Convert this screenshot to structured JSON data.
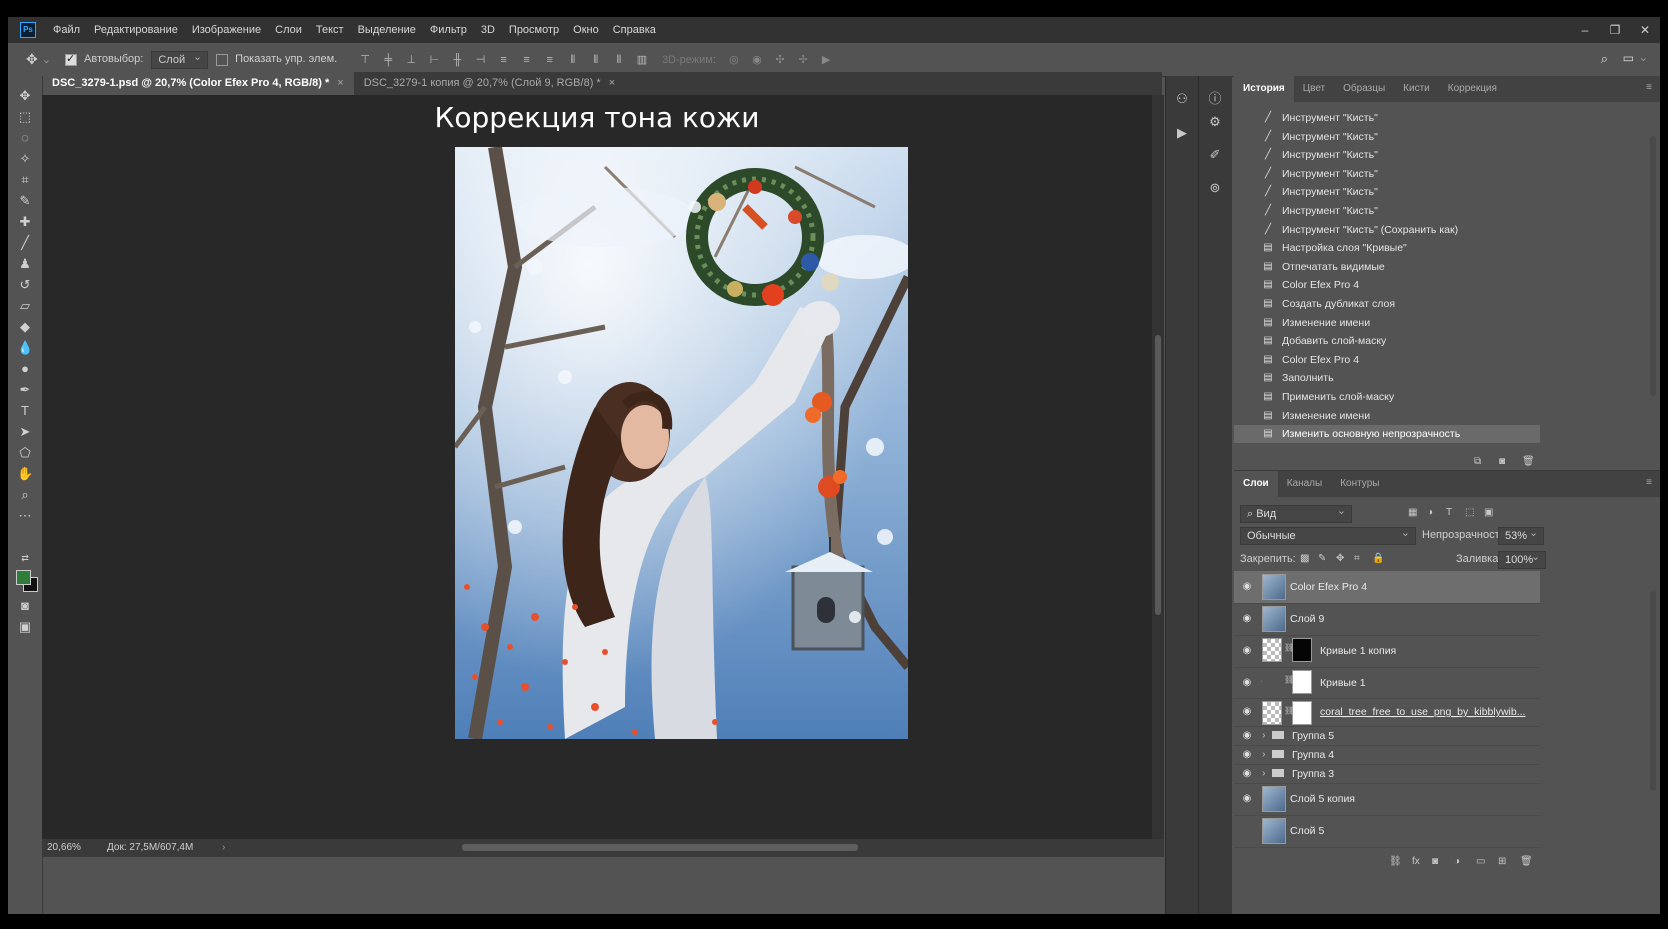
{
  "app": {
    "logo": "Ps"
  },
  "menu": [
    "Файл",
    "Редактирование",
    "Изображение",
    "Слои",
    "Текст",
    "Выделение",
    "Фильтр",
    "3D",
    "Просмотр",
    "Окно",
    "Справка"
  ],
  "options": {
    "autoselect_label": "Автовыбор:",
    "autoselect_value": "Слой",
    "show_transform_label": "Показать упр. элем.",
    "mode_3d": "3D-режим:"
  },
  "tabs": [
    {
      "label": "DSC_3279-1.psd @ 20,7% (Color Efex Pro 4, RGB/8) *",
      "close": "×"
    },
    {
      "label": "DSC_3279-1 копия @ 20,7% (Слой 9, RGB/8) *",
      "close": "×"
    }
  ],
  "canvas": {
    "headline": "Коррекция тона кожи"
  },
  "status": {
    "zoom": "20,66%",
    "doc": "Док: 27,5M/607,4M"
  },
  "history_panel": {
    "tabs": [
      "История",
      "Цвет",
      "Образцы",
      "Кисти",
      "Коррекция"
    ],
    "items": [
      {
        "icon": "brush-icon",
        "label": "Инструмент \"Кисть\""
      },
      {
        "icon": "brush-icon",
        "label": "Инструмент \"Кисть\""
      },
      {
        "icon": "brush-icon",
        "label": "Инструмент \"Кисть\""
      },
      {
        "icon": "brush-icon",
        "label": "Инструмент \"Кисть\""
      },
      {
        "icon": "brush-icon",
        "label": "Инструмент \"Кисть\""
      },
      {
        "icon": "brush-icon",
        "label": "Инструмент \"Кисть\""
      },
      {
        "icon": "brush-icon",
        "label": "Инструмент \"Кисть\" (Сохранить как)"
      },
      {
        "icon": "doc-icon",
        "label": "Настройка слоя \"Кривые\""
      },
      {
        "icon": "doc-icon",
        "label": "Отпечатать видимые"
      },
      {
        "icon": "doc-icon",
        "label": "Color Efex Pro 4"
      },
      {
        "icon": "doc-icon",
        "label": "Создать дубликат слоя"
      },
      {
        "icon": "doc-icon",
        "label": "Изменение имени"
      },
      {
        "icon": "doc-icon",
        "label": "Добавить слой-маску"
      },
      {
        "icon": "doc-icon",
        "label": "Color Efex Pro 4"
      },
      {
        "icon": "doc-icon",
        "label": "Заполнить"
      },
      {
        "icon": "doc-icon",
        "label": "Применить слой-маску"
      },
      {
        "icon": "doc-icon",
        "label": "Изменение имени"
      },
      {
        "icon": "doc-icon",
        "label": "Изменить основную непрозрачность"
      }
    ],
    "selected_index": 17
  },
  "layers_panel": {
    "tabs": [
      "Слои",
      "Каналы",
      "Контуры"
    ],
    "filter_label": "Вид",
    "blend_mode": "Обычные",
    "opacity_label": "Непрозрачность:",
    "opacity_value": "53%",
    "lock_label": "Закрепить:",
    "fill_label": "Заливка:",
    "fill_value": "100%",
    "layers": [
      {
        "name": "Color Efex Pro 4",
        "kind": "photo",
        "selected": true
      },
      {
        "name": "Слой 9",
        "kind": "photo"
      },
      {
        "name": "Кривые 1 копия",
        "kind": "adjust-black"
      },
      {
        "name": "Кривые 1",
        "kind": "adjust-white"
      },
      {
        "name": "coral_tree_free_to_use_png_by_kibblywib...",
        "kind": "masked"
      },
      {
        "name": "Группа 5",
        "kind": "group"
      },
      {
        "name": "Группа 4",
        "kind": "group"
      },
      {
        "name": "Группа 3",
        "kind": "group"
      },
      {
        "name": "Слой 5 копия",
        "kind": "photo"
      },
      {
        "name": "Слой 5",
        "kind": "photo"
      }
    ]
  },
  "colors": {
    "fg": "#2e7d3a",
    "bg": "#111111",
    "panel": "#535353",
    "canvas": "#282828"
  }
}
